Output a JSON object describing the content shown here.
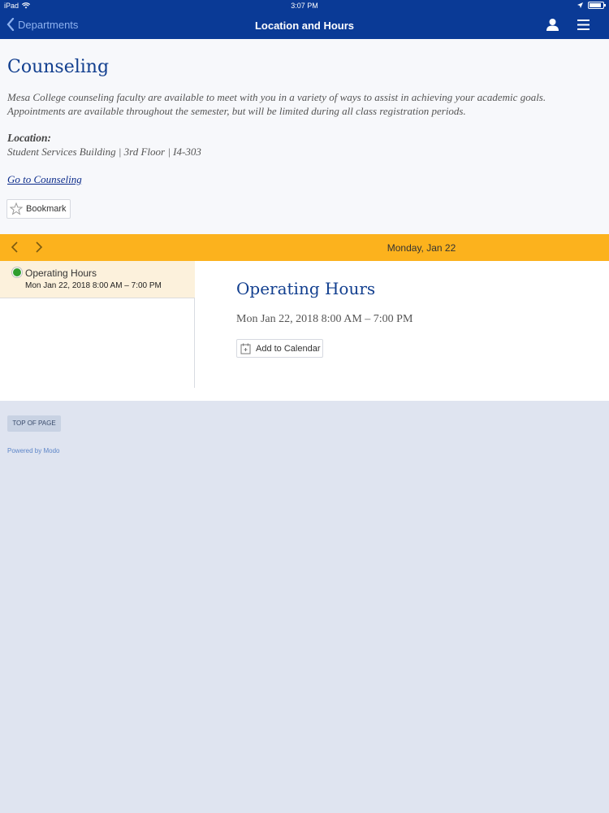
{
  "status_bar": {
    "device": "iPad",
    "time": "3:07 PM"
  },
  "nav": {
    "back_label": "Departments",
    "title": "Location and Hours"
  },
  "page": {
    "title": "Counseling",
    "intro": "Mesa College counseling faculty are available to meet with you in a variety of ways to assist in achieving your academic goals. Appointments are available throughout the semester, but will be limited during all class registration periods.",
    "location_label": "Location:",
    "location_value": "Student Services Building | 3rd Floor | I4-303",
    "link_label": "Go to Counseling",
    "bookmark_label": "Bookmark"
  },
  "date_bar": {
    "date": "Monday, Jan 22",
    "color": "#fcb21d"
  },
  "events": [
    {
      "title": "Operating Hours",
      "time": "Mon Jan 22, 2018 8:00 AM – 7:00 PM",
      "status_color": "#2e9e2e"
    }
  ],
  "detail": {
    "title": "Operating Hours",
    "time": "Mon Jan 22, 2018 8:00 AM – 7:00 PM",
    "add_calendar_label": "Add to Calendar"
  },
  "footer": {
    "top_label": "TOP OF PAGE",
    "powered": "Powered by Modo"
  },
  "colors": {
    "brand": "#0a3a96",
    "title": "#123f8f",
    "accent": "#fcb21d"
  }
}
